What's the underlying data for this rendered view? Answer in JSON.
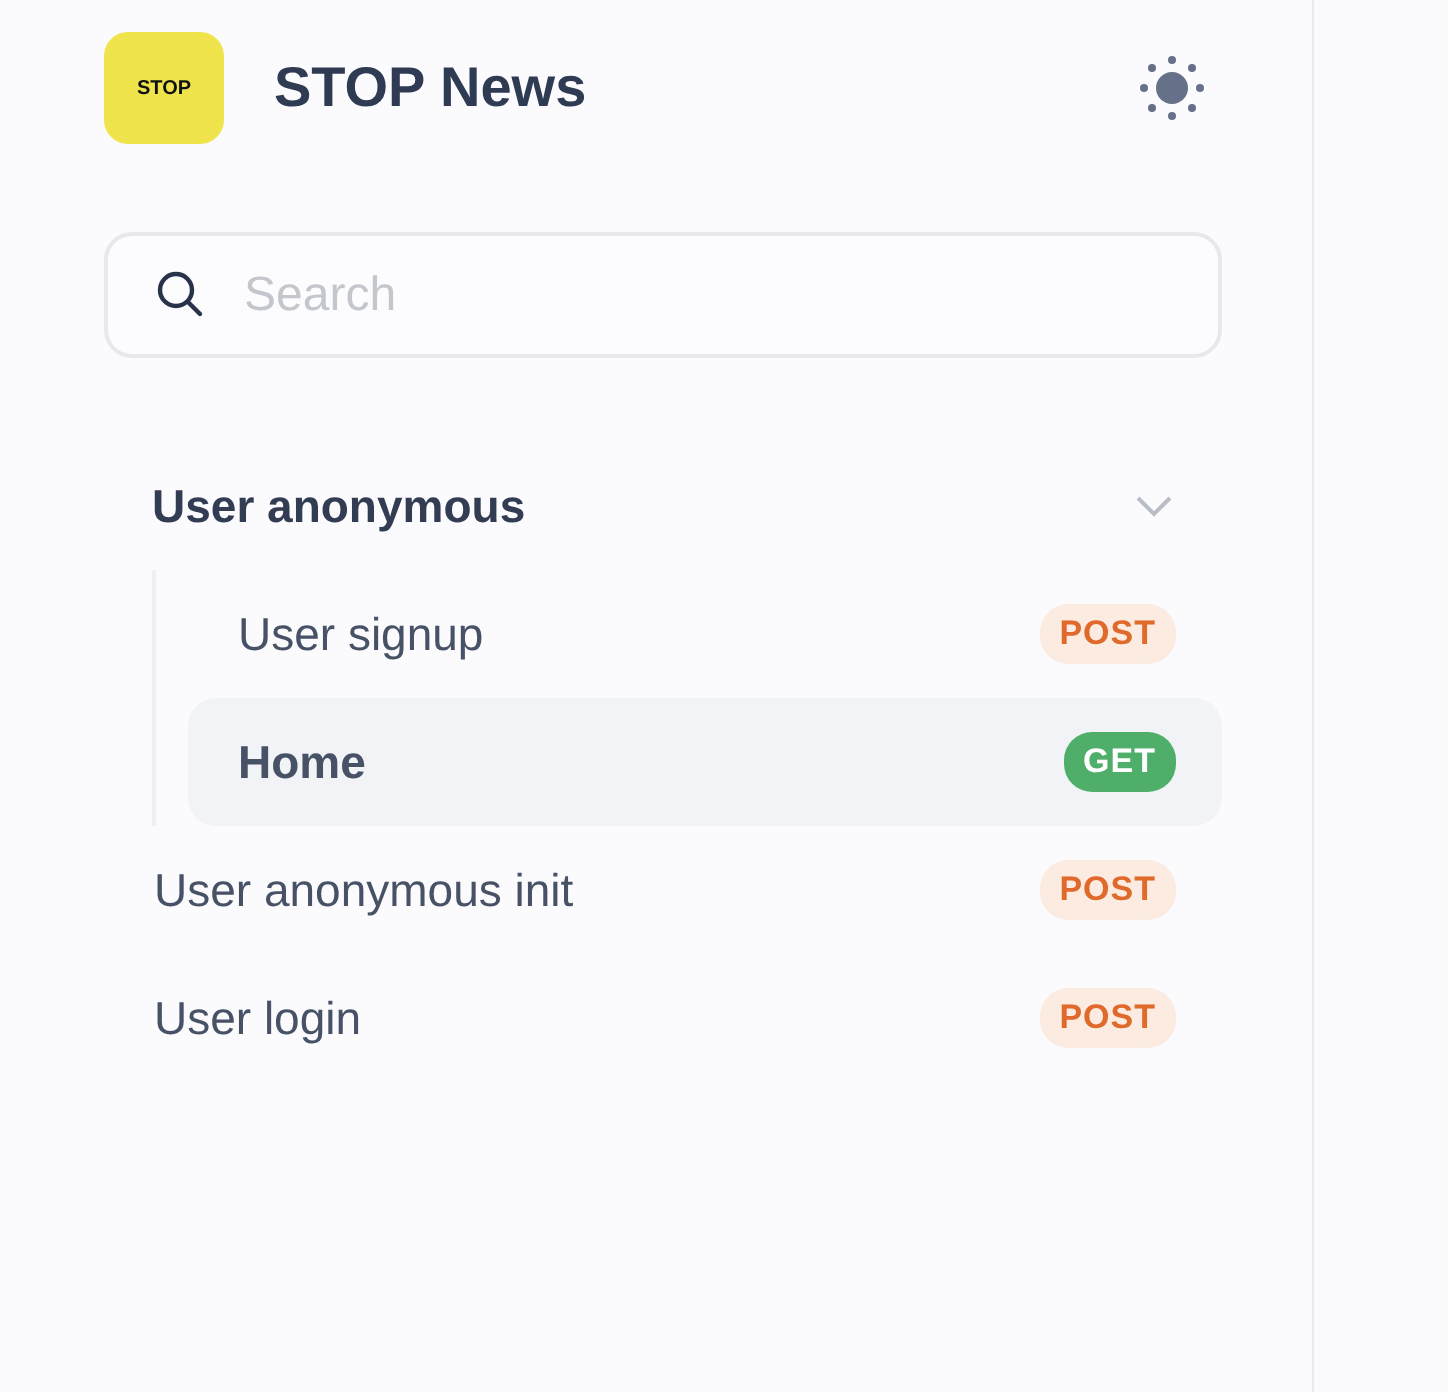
{
  "brand": {
    "logo_text": "STOP",
    "title": "STOP News"
  },
  "search": {
    "placeholder": "Search"
  },
  "nav": [
    {
      "label": "User anonymous",
      "kind": "group",
      "expanded": true,
      "children": [
        {
          "label": "User signup",
          "method": "POST",
          "selected": false
        },
        {
          "label": "Home",
          "method": "GET",
          "selected": true
        }
      ]
    },
    {
      "label": "User anonymous init",
      "kind": "item",
      "method": "POST",
      "selected": false
    },
    {
      "label": "User login",
      "kind": "item",
      "method": "POST",
      "selected": false
    }
  ]
}
